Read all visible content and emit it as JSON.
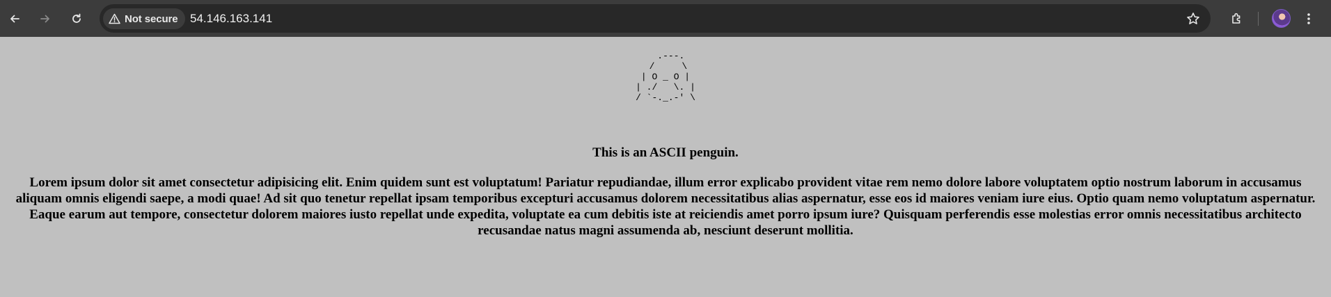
{
  "browser": {
    "security_label": "Not secure",
    "url": "54.146.163.141",
    "icons": [
      "back-icon",
      "forward-icon",
      "reload-icon",
      "warning-icon",
      "star-icon",
      "extensions-icon",
      "avatar",
      "kebab-menu-icon"
    ]
  },
  "page": {
    "ascii_penguin": "  .---.\n /     \\\n| O _ O |\n| ./   \\. |\n/ `-._.-' \\",
    "caption": "This is an ASCII penguin.",
    "paragraph": "Lorem ipsum dolor sit amet consectetur adipisicing elit. Enim quidem sunt est voluptatum! Pariatur repudiandae, illum error explicabo provident vitae rem nemo dolore labore voluptatem optio nostrum laborum in accusamus aliquam omnis eligendi saepe, a modi quae! Ad sit quo tenetur repellat ipsam temporibus excepturi accusamus dolorem necessitatibus alias aspernatur, esse eos id maiores veniam iure eius. Optio quam nemo voluptatum aspernatur. Eaque earum aut tempore, consectetur dolorem maiores iusto repellat unde expedita, voluptate ea cum debitis iste at reiciendis amet porro ipsum iure? Quisquam perferendis esse molestias error omnis necessitatibus architecto recusandae natus magni assumenda ab, nesciunt deserunt mollitia."
  },
  "colors": {
    "toolbar_bg": "#3c3c3c",
    "omnibox_bg": "#282828",
    "page_bg": "#c0c0c0"
  }
}
